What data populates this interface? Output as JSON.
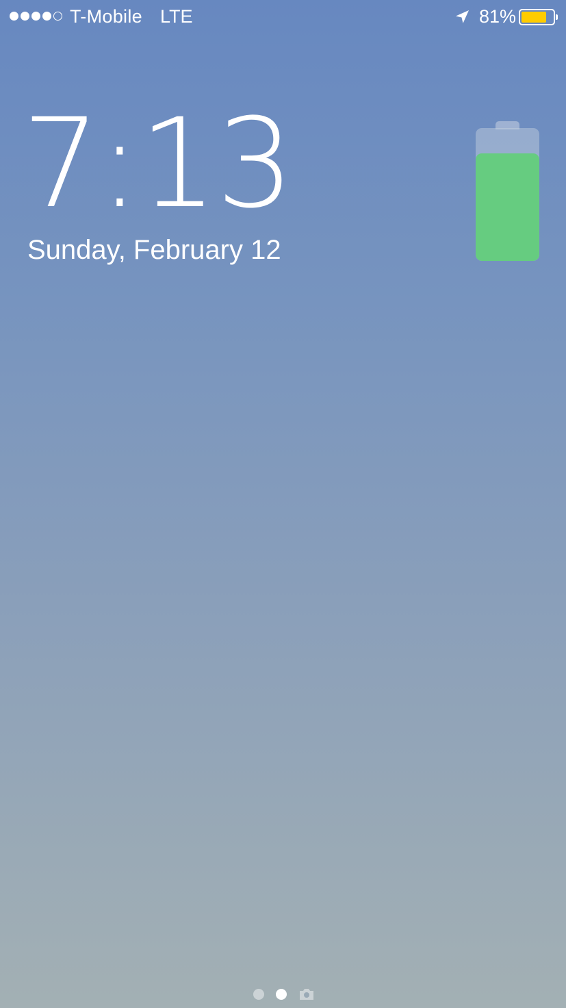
{
  "status_bar": {
    "signal": {
      "bars_filled": 4,
      "bars_total": 5,
      "icon": "signal-strength-icon"
    },
    "carrier": "T-Mobile",
    "network": "LTE",
    "location_icon": "location-arrow-icon",
    "battery_percent_text": "81%",
    "battery_level": 0.81,
    "battery_fill_color": "#ffcc00"
  },
  "lock_screen": {
    "time": "7:13",
    "date": "Sunday, February 12",
    "charging_battery": {
      "icon": "charging-battery-icon",
      "level": 0.81,
      "color": "#66cc80"
    }
  },
  "page_indicator": {
    "pages": 2,
    "active_index": 1,
    "camera_icon": "camera-icon"
  },
  "colors": {
    "background_top": "#6788c0",
    "background_bottom": "#a3b0b4",
    "text": "#ffffff"
  }
}
